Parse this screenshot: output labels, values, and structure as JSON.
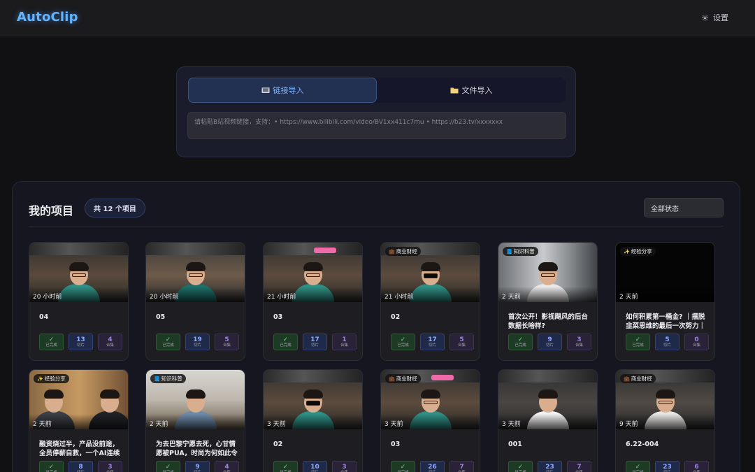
{
  "app": {
    "title": "AutoClip",
    "settings_label": "设置"
  },
  "import": {
    "tabs": [
      {
        "label": "链接导入",
        "icon": "video-camera-icon",
        "active": true
      },
      {
        "label": "文件导入",
        "icon": "folder-icon",
        "active": false
      }
    ],
    "placeholder": "请粘贴B站视频链接，支持：• https://www.bilibili.com/video/BV1xx411c7mu • https://b23.tv/xxxxxxx"
  },
  "projects": {
    "title": "我的项目",
    "count_label": "共 12 个项目",
    "filter_label": "全部状态",
    "status_label": "已完成",
    "clips_label": "切片",
    "collections_label": "合集",
    "items": [
      {
        "time": "20 小时前",
        "title": "04",
        "tag": "",
        "status": "✓",
        "clips": "13",
        "collections": "4"
      },
      {
        "time": "20 小时前",
        "title": "05",
        "tag": "",
        "status": "✓",
        "clips": "19",
        "collections": "5"
      },
      {
        "time": "21 小时前",
        "title": "03",
        "tag": "",
        "status": "✓",
        "clips": "17",
        "collections": "1"
      },
      {
        "time": "21 小时前",
        "title": "02",
        "tag": "商业财经",
        "status": "✓",
        "clips": "17",
        "collections": "5"
      },
      {
        "time": "2 天前",
        "title": "首次公开！影视飓风的后台数据长啥样?",
        "tag": "知识科普",
        "status": "✓",
        "clips": "9",
        "collections": "3"
      },
      {
        "time": "2 天前",
        "title": "如何积累第一桶金? ｜摆脱韭菜思维的最后一次努力｜",
        "tag": "经验分享",
        "status": "✓",
        "clips": "5",
        "collections": "0"
      },
      {
        "time": "2 天前",
        "title": "融资烧过半，产品没前途，全员停薪自救，一个AI连续",
        "tag": "经验分享",
        "status": "✓",
        "clips": "8",
        "collections": "3"
      },
      {
        "time": "2 天前",
        "title": "为去巴黎宁愿去死，心甘情愿被PUA，时尚为何如此令",
        "tag": "知识科普",
        "status": "✓",
        "clips": "9",
        "collections": "4"
      },
      {
        "time": "3 天前",
        "title": "02",
        "tag": "",
        "status": "✓",
        "clips": "10",
        "collections": "3"
      },
      {
        "time": "3 天前",
        "title": "03",
        "tag": "商业财经",
        "status": "✓",
        "clips": "26",
        "collections": "7"
      },
      {
        "time": "3 天前",
        "title": "001",
        "tag": "",
        "status": "✓",
        "clips": "23",
        "collections": "7"
      },
      {
        "time": "9 天前",
        "title": "6.22-004",
        "tag": "商业财经",
        "status": "✓",
        "clips": "23",
        "collections": "6"
      }
    ]
  },
  "colors": {
    "accent": "#63b3ff",
    "done": "#7cd18a",
    "clips": "#8ea8ff",
    "collections": "#9e86d6"
  }
}
